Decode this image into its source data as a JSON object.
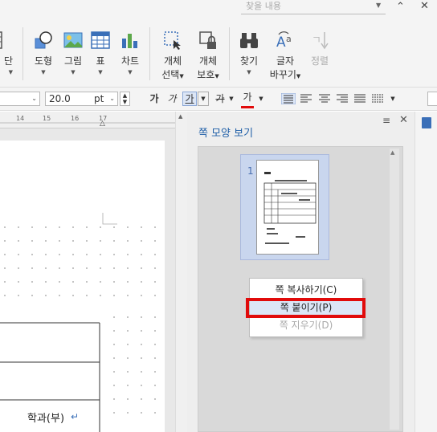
{
  "search": {
    "placeholder": "찾을 내용"
  },
  "ribbon": {
    "buttons": [
      {
        "label": "단",
        "icon": "columns-icon"
      },
      {
        "label": "도형",
        "icon": "shape-icon"
      },
      {
        "label": "그림",
        "icon": "picture-icon"
      },
      {
        "label": "표",
        "icon": "table-icon"
      },
      {
        "label": "차트",
        "icon": "chart-icon"
      },
      {
        "label": "개체",
        "label2": "선택",
        "icon": "select-object-icon"
      },
      {
        "label": "개체",
        "label2": "보호",
        "icon": "protect-object-icon"
      },
      {
        "label": "찾기",
        "icon": "binoculars-icon"
      },
      {
        "label": "글자",
        "label2": "바꾸기",
        "icon": "replace-text-icon"
      },
      {
        "label": "정렬",
        "icon": "sort-icon"
      }
    ]
  },
  "format": {
    "font_size": "20.0",
    "unit": "pt",
    "bold": "가",
    "italic": "가",
    "underline": "가",
    "strike": "가",
    "color": "가",
    "accent_red": "#e10b0b"
  },
  "ruler": {
    "ticks": [
      "14",
      "15",
      "16",
      "17"
    ]
  },
  "document": {
    "cell_text": "학과(부)"
  },
  "panel": {
    "title": "쪽 모양 보기",
    "page_number": "1"
  },
  "context_menu": {
    "items": [
      {
        "label": "쪽 복사하기(C)",
        "enabled": true
      },
      {
        "label": "쪽 붙이기(P)",
        "enabled": true
      },
      {
        "label": "쪽 지우기(D)",
        "enabled": false
      }
    ]
  }
}
